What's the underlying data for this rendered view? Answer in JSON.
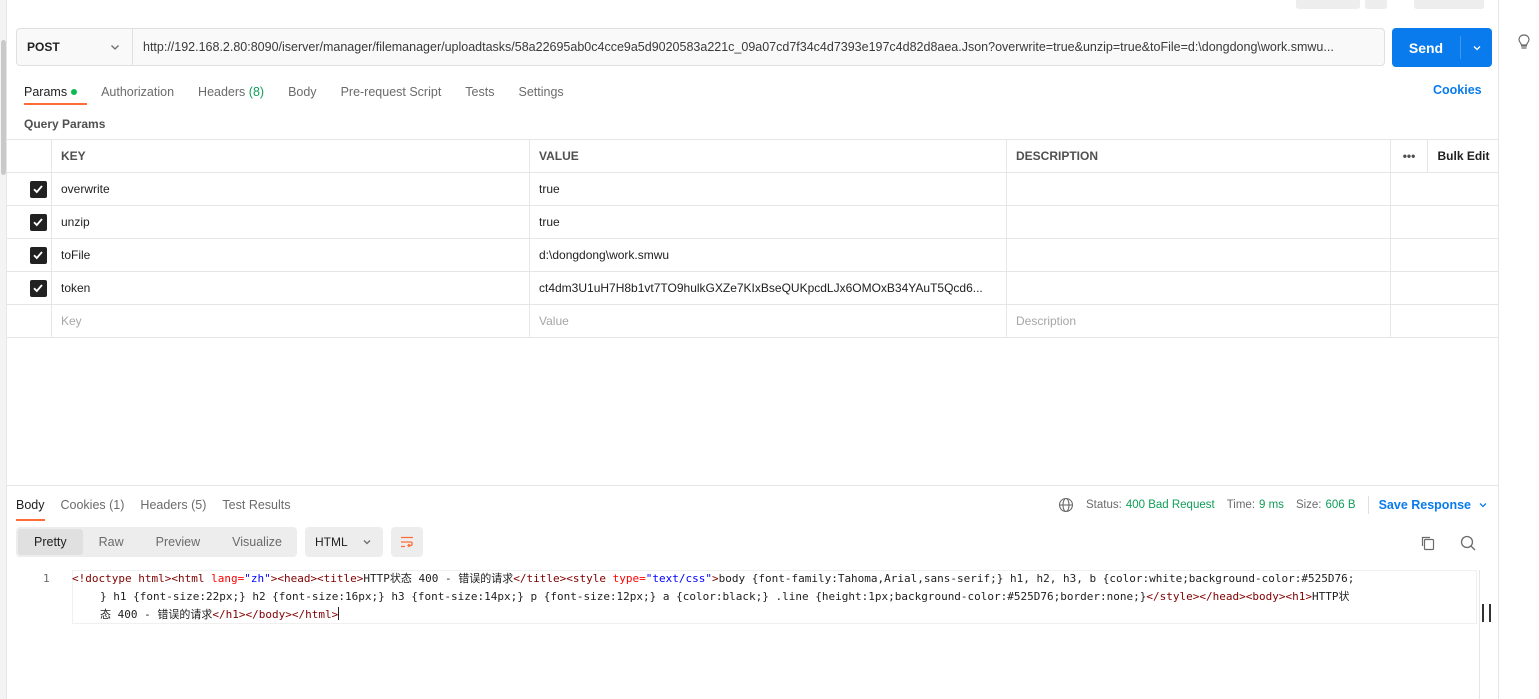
{
  "request": {
    "method": "POST",
    "url": "http://192.168.2.80:8090/iserver/manager/filemanager/uploadtasks/58a22695ab0c4cce9a5d9020583a221c_09a07cd7f34c4d7393e197c4d82d8aea.Json?overwrite=true&unzip=true&toFile=d:\\dongdong\\work.smwu...",
    "send_label": "Send"
  },
  "tabs": {
    "params": "Params",
    "authorization": "Authorization",
    "headers": "Headers",
    "headers_count": "(8)",
    "body": "Body",
    "prerequest": "Pre-request Script",
    "tests": "Tests",
    "settings": "Settings",
    "cookies": "Cookies"
  },
  "query_params": {
    "title": "Query Params",
    "headers": {
      "key": "KEY",
      "value": "VALUE",
      "description": "DESCRIPTION",
      "more": "•••",
      "bulk_edit": "Bulk Edit"
    },
    "rows": [
      {
        "key": "overwrite",
        "value": "true",
        "description": ""
      },
      {
        "key": "unzip",
        "value": "true",
        "description": ""
      },
      {
        "key": "toFile",
        "value": "d:\\dongdong\\work.smwu",
        "description": ""
      },
      {
        "key": "token",
        "value": "ct4dm3U1uH7H8b1vt7TO9hulkGXZe7KIxBseQUKpcdLJx6OMOxB34YAuT5Qcd6...",
        "description": ""
      }
    ],
    "placeholders": {
      "key": "Key",
      "value": "Value",
      "description": "Description"
    }
  },
  "response": {
    "tabs": {
      "body": "Body",
      "cookies": "Cookies (1)",
      "headers": "Headers (5)",
      "test_results": "Test Results"
    },
    "status_label": "Status:",
    "status_value": "400 Bad Request",
    "time_label": "Time:",
    "time_value": "9 ms",
    "size_label": "Size:",
    "size_value": "606 B",
    "save": "Save Response",
    "views": {
      "pretty": "Pretty",
      "raw": "Raw",
      "preview": "Preview",
      "visualize": "Visualize"
    },
    "format": "HTML",
    "code": {
      "line_number": "1",
      "l1_p1": "<!doctype html><html ",
      "l1_attr1": "lang=",
      "l1_str1": "\"zh\"",
      "l1_p2": "><head><title>",
      "l1_t1": "HTTP状态 400 - 错误的请求",
      "l1_p3": "</title><style ",
      "l1_attr2": "type=",
      "l1_str2": "\"text/css\"",
      "l1_p4": ">",
      "l1_css": "body {font-family:Tahoma,Arial,sans-serif;} h1, h2, h3, b {color:white;background-color:#525D76;",
      "l2_css": "} h1 {font-size:22px;} h2 {font-size:16px;} h3 {font-size:14px;} p {font-size:12px;} a {color:black;} .line {height:1px;background-color:#525D76;border:none;}",
      "l2_tag": "</style></head><body><h1>",
      "l2_t": "HTTP状",
      "l3_t": "态 400 - 错误的请求",
      "l3_tag1": "</h1></body>",
      "l3_tag2": "</html>"
    }
  },
  "colors": {
    "accent": "#ff6c37",
    "primary": "#097bed",
    "success": "#0f9d58"
  }
}
